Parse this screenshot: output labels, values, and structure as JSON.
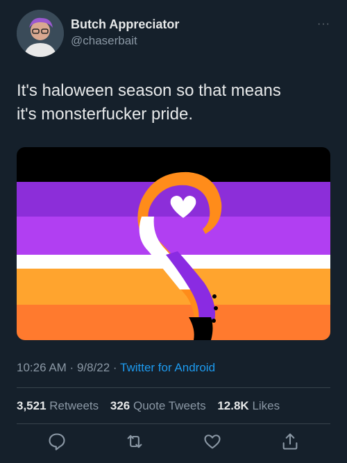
{
  "user": {
    "display_name": "Butch Appreciator",
    "handle": "@chaserbait",
    "more_label": "···"
  },
  "tweet": {
    "text_line1": "It's haloween season so that means",
    "text_line2": "it's monsterfucker pride."
  },
  "media": {
    "flag_stripes": [
      "#000000",
      "#8c2ed9",
      "#b13ff2",
      "#ffffff",
      "#ffa42e",
      "#ff7a2e"
    ],
    "tentacle_colors": {
      "top": "#ff8c1a",
      "middle": "#ffffff",
      "lower": "#8a2be2",
      "tip": "#000000"
    }
  },
  "meta": {
    "time": "10:26 AM",
    "sep1": " · ",
    "date": "9/8/22",
    "sep2": " · ",
    "source": "Twitter for Android"
  },
  "stats": {
    "retweets_count": "3,521",
    "retweets_label": "Retweets",
    "quotes_count": "326",
    "quotes_label": "Quote Tweets",
    "likes_count": "12.8K",
    "likes_label": "Likes"
  },
  "actions": {
    "reply": "reply-icon",
    "retweet": "retweet-icon",
    "like": "heart-icon",
    "share": "share-icon"
  }
}
